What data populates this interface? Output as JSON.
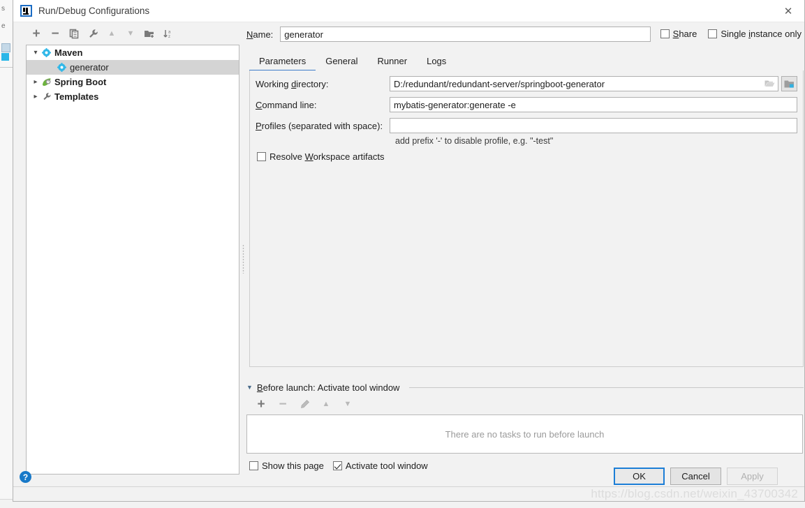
{
  "window": {
    "title": "Run/Debug Configurations",
    "logo_icon": "intellij-idea-logo-icon",
    "close_icon": "close-icon"
  },
  "background": {
    "left_labels": [
      "s",
      "e"
    ]
  },
  "tree_toolbar": {
    "buttons": [
      {
        "name": "add-configuration-button",
        "icon": "plus-icon",
        "glyph": "+",
        "enabled": true
      },
      {
        "name": "remove-configuration-button",
        "icon": "minus-icon",
        "glyph": "−",
        "enabled": true
      },
      {
        "name": "copy-configuration-button",
        "icon": "copy-icon",
        "glyph": "❐",
        "enabled": true
      },
      {
        "name": "edit-templates-button",
        "icon": "wrench-icon",
        "glyph": "🔧",
        "enabled": true
      },
      {
        "name": "move-up-button",
        "icon": "arrow-up-icon",
        "glyph": "▲",
        "enabled": false
      },
      {
        "name": "move-down-button",
        "icon": "arrow-down-icon",
        "glyph": "▼",
        "enabled": false
      },
      {
        "name": "new-folder-button",
        "icon": "folder-add-icon",
        "glyph": "▰",
        "enabled": true
      },
      {
        "name": "sort-configurations-button",
        "icon": "sort-alphabetically-icon",
        "glyph": "↓",
        "enabled": true
      }
    ]
  },
  "tree": {
    "nodes": [
      {
        "label": "Maven",
        "icon": "maven-gear-icon",
        "twisty": "expanded",
        "indent": 0,
        "bold": true,
        "selected": false
      },
      {
        "label": "generator",
        "icon": "maven-gear-icon",
        "twisty": "none",
        "indent": 1,
        "bold": false,
        "selected": true
      },
      {
        "label": "Spring Boot",
        "icon": "spring-boot-leaf-icon",
        "twisty": "collapsed",
        "indent": 0,
        "bold": true,
        "selected": false
      },
      {
        "label": "Templates",
        "icon": "wrench-icon",
        "twisty": "collapsed",
        "indent": 0,
        "bold": true,
        "selected": false
      }
    ]
  },
  "splitter": {
    "name": "panel-splitter",
    "grip_icon": "drag-grip-icon"
  },
  "name_field": {
    "label": "Name:",
    "label_mnemonic": "N",
    "value": "generator",
    "placeholder": ""
  },
  "top_checkboxes": [
    {
      "name": "share-checkbox",
      "label": "Share",
      "mnemonic": "S",
      "checked": false
    },
    {
      "name": "single-instance-only-checkbox",
      "label": "Single instance only",
      "mnemonic": "i",
      "checked": false
    }
  ],
  "tabs": [
    {
      "label": "Parameters",
      "active": true
    },
    {
      "label": "General",
      "active": false
    },
    {
      "label": "Runner",
      "active": false
    },
    {
      "label": "Logs",
      "active": false
    }
  ],
  "parameters": {
    "working_directory": {
      "label": "Working directory:",
      "mnemonic": "d",
      "value": "D:/redundant/redundant-server/springboot-generator",
      "inline_icon": "folder-open-icon",
      "module_button_icon": "module-folder-icon"
    },
    "command_line": {
      "label": "Command line:",
      "mnemonic": "C",
      "value": "mybatis-generator:generate -e"
    },
    "profiles": {
      "label": "Profiles (separated with space):",
      "mnemonic": "P",
      "value": "",
      "hint": "add prefix '-' to disable profile, e.g. \"-test\""
    },
    "resolve_workspace_artifacts": {
      "name": "resolve-workspace-artifacts-checkbox",
      "label": "Resolve Workspace artifacts",
      "mnemonic": "W",
      "checked": false
    }
  },
  "before_launch": {
    "title": "Before launch: Activate tool window",
    "mnemonic": "B",
    "collapse_icon": "triangle-down-icon",
    "toolbar": [
      {
        "name": "add-task-button",
        "icon": "plus-icon",
        "glyph": "+",
        "enabled": true
      },
      {
        "name": "remove-task-button",
        "icon": "minus-icon",
        "glyph": "−",
        "enabled": false
      },
      {
        "name": "edit-task-button",
        "icon": "pencil-icon",
        "glyph": "✎",
        "enabled": false
      },
      {
        "name": "task-move-up-button",
        "icon": "arrow-up-icon",
        "glyph": "▲",
        "enabled": false
      },
      {
        "name": "task-move-down-button",
        "icon": "arrow-down-icon",
        "glyph": "▼",
        "enabled": false
      }
    ],
    "empty_text": "There are no tasks to run before launch",
    "checkboxes": [
      {
        "name": "show-this-page-checkbox",
        "label": "Show this page",
        "checked": false
      },
      {
        "name": "activate-tool-window-checkbox",
        "label": "Activate tool window",
        "checked": true
      }
    ]
  },
  "footer": {
    "help_icon": "help-question-icon",
    "help_glyph": "?",
    "buttons": [
      {
        "name": "ok-button",
        "label": "OK",
        "style": "default",
        "enabled": true
      },
      {
        "name": "cancel-button",
        "label": "Cancel",
        "style": "normal",
        "enabled": true
      },
      {
        "name": "apply-button",
        "label": "Apply",
        "style": "disabled",
        "enabled": false
      }
    ]
  },
  "watermark": "https://blog.csdn.net/weixin_43700342",
  "colors": {
    "accent": "#3d7cc9",
    "default_button_border": "#1c7ed6",
    "selection": "#d4d4d4",
    "maven_gear": "#2fb7e8",
    "spring_green": "#6db33f",
    "help_blue": "#1879c8",
    "dialog_bg": "#f2f2f2"
  }
}
